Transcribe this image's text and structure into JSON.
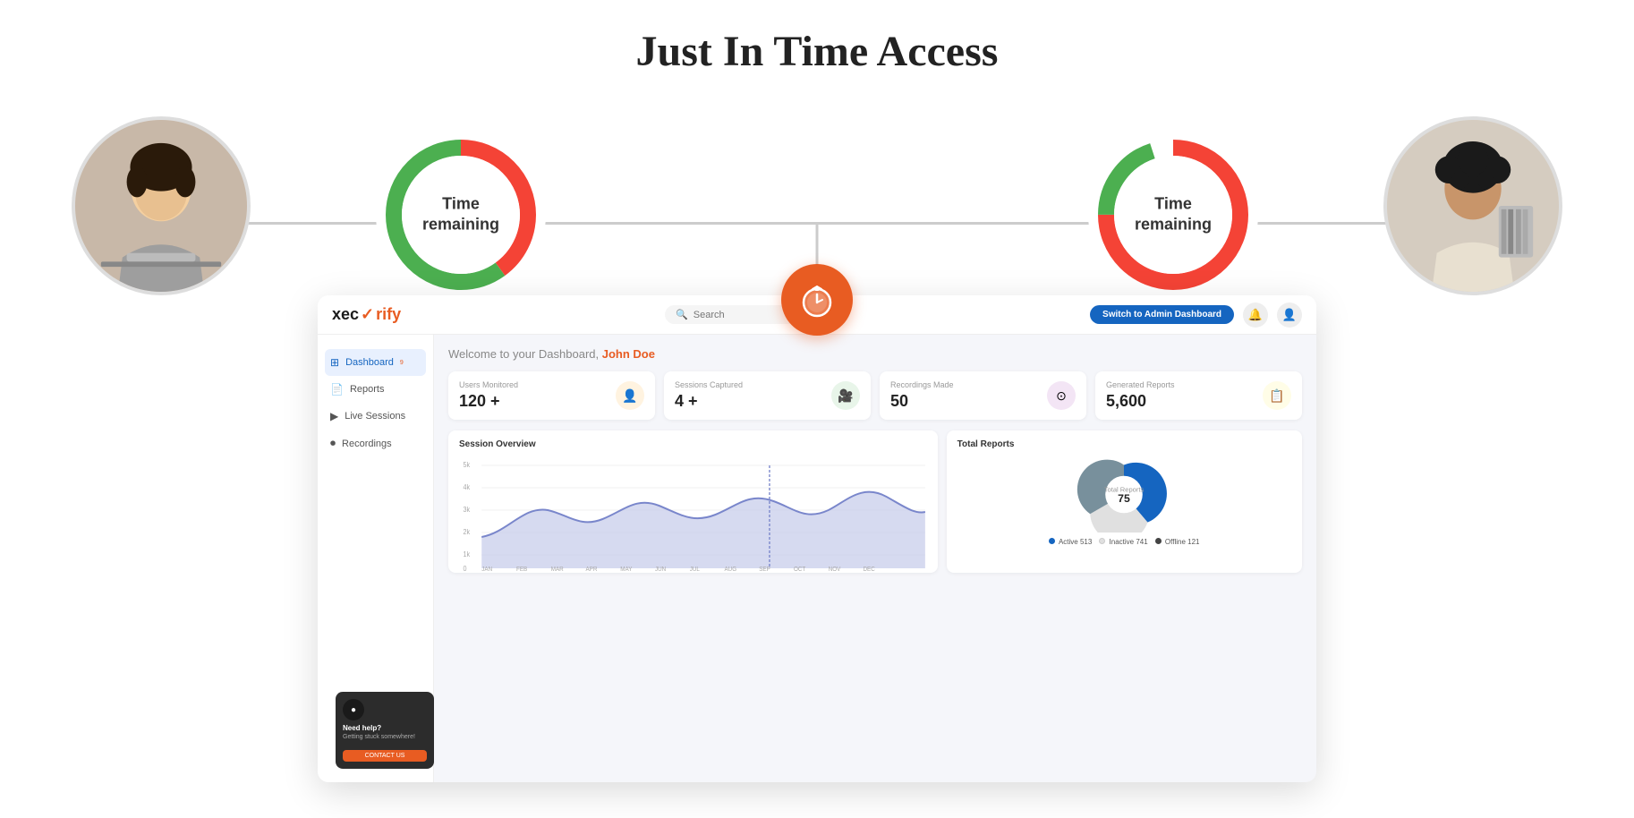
{
  "page": {
    "title": "Just In Time Access"
  },
  "timer_left": {
    "label": "Time remaining",
    "pct_green": 0.6,
    "pct_red": 0.4
  },
  "timer_right": {
    "label": "Time remaining",
    "pct_red": 0.75,
    "pct_green": 0.25
  },
  "brand": {
    "name_part1": "xec",
    "checkmark": "✓",
    "name_part2": "rify"
  },
  "search": {
    "placeholder": "Search"
  },
  "nav": {
    "admin_btn": "Switch to Admin Dashboard"
  },
  "sidebar": {
    "items": [
      {
        "label": "Dashboard",
        "active": true
      },
      {
        "label": "Reports",
        "active": false
      },
      {
        "label": "Live Sessions",
        "active": false
      },
      {
        "label": "Recordings",
        "active": false
      }
    ]
  },
  "welcome": {
    "text": "Welcome to your Dashboard,",
    "user": "John Doe"
  },
  "stats": [
    {
      "label": "Users Monitored",
      "value": "120 +",
      "icon": "👤",
      "color": "orange"
    },
    {
      "label": "Sessions Captured",
      "value": "4 +",
      "icon": "🎥",
      "color": "green"
    },
    {
      "label": "Recordings Made",
      "value": "50",
      "icon": "⊙",
      "color": "purple"
    },
    {
      "label": "Generated Reports",
      "value": "5,600",
      "icon": "📋",
      "color": "yellow"
    }
  ],
  "session_overview": {
    "title": "Session Overview",
    "months": [
      "JAN",
      "FEB",
      "MAR",
      "APR",
      "MAY",
      "JUN",
      "JUL",
      "AUG",
      "SEP",
      "OCT",
      "NOV",
      "DEC"
    ],
    "y_labels": [
      "5k",
      "4k",
      "3k",
      "2k",
      "1k",
      "0"
    ]
  },
  "total_reports": {
    "title": "Total Reports",
    "value": "75",
    "legend": [
      {
        "label": "Active",
        "value": "513",
        "color": "#1565c0"
      },
      {
        "label": "Inactive",
        "value": "741",
        "color": "#e0e0e0"
      },
      {
        "label": "Offline",
        "value": "121",
        "color": "#444"
      }
    ]
  },
  "help": {
    "title": "Need help?",
    "subtitle": "Getting stuck somewhere!",
    "button": "CONTACT US"
  }
}
